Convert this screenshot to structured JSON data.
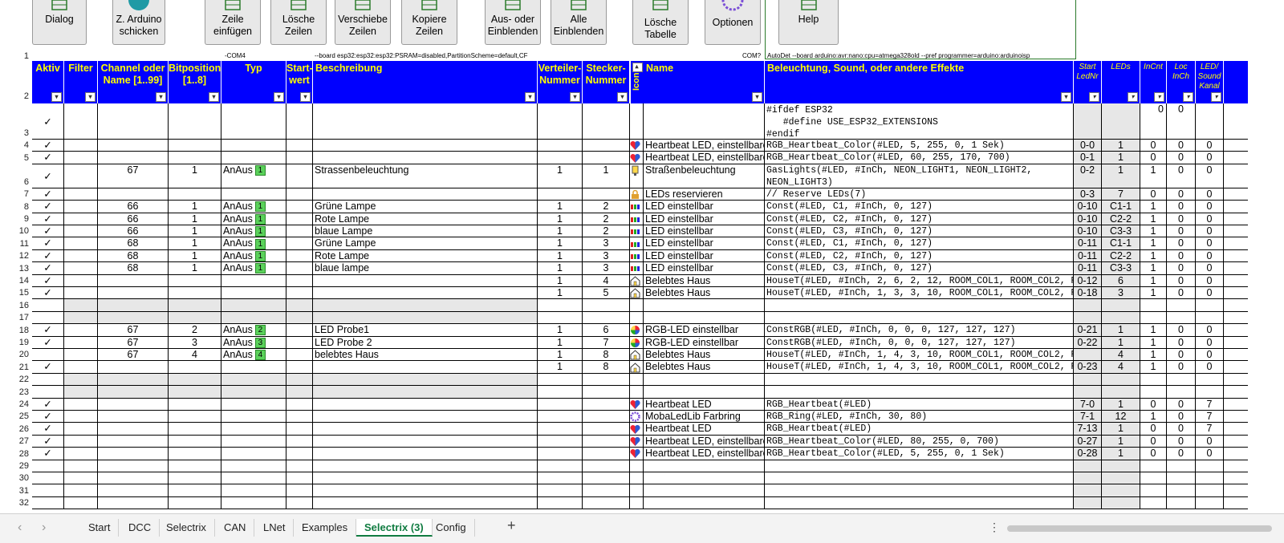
{
  "ribbon": {
    "buttons": [
      {
        "label": "Dialog"
      },
      {
        "label": "Z. Arduino\nschicken"
      },
      {
        "label": "Zeile\neinfügen"
      },
      {
        "label": "Lösche\nZeilen"
      },
      {
        "label": "Verschiebe\nZeilen"
      },
      {
        "label": "Kopiere\nZeilen"
      },
      {
        "label": "Aus- oder\nEinblenden"
      },
      {
        "label": "Alle\nEinblenden"
      },
      {
        "label": "Lösche\nTabelle"
      },
      {
        "label": "Optionen"
      },
      {
        "label": "Help"
      }
    ]
  },
  "row1": {
    "num": "1",
    "com4": "-COM4",
    "board": "--board esp32:esp32:esp32:PSRAM=disabled,PartitionScheme=default,CF",
    "com": "COM?",
    "autodet": "AutoDet --board arduino:avr:nano:cpu=atmega328old --pref programmer=arduino:arduinoisp"
  },
  "header": {
    "num": "2",
    "cols": [
      "Aktiv",
      "Filter",
      "Channel oder Name [1..99]",
      "Bitposition [1..8]",
      "Typ",
      "Start-wert",
      "Beschreibung",
      "Verteiler-Nummer",
      "Stecker-Nummer",
      "Icon",
      "Name",
      "Beleuchtung, Sound, oder andere Effekte",
      "Start LedNr",
      "LEDs",
      "InCnt",
      "Loc InCh",
      "LED/ Sound Kanal"
    ]
  },
  "rows": [
    {
      "n": "3",
      "a": "✓",
      "ch": "",
      "bp": "",
      "typ": "",
      "tb": "",
      "desc": "",
      "v": "",
      "s": "",
      "icon": "",
      "name": "",
      "eff": "#ifdef ESP32\n   #define USE_ESP32_EXTENSIONS\n#endif",
      "st": "",
      "leds": "",
      "inc": "0",
      "loc": "0",
      "kan": ""
    },
    {
      "n": "4",
      "a": "✓",
      "ch": "",
      "bp": "",
      "typ": "",
      "tb": "",
      "desc": "",
      "v": "",
      "s": "",
      "icon": "heart",
      "name": "Heartbeat LED, einstellbare",
      "eff": "RGB_Heartbeat_Color(#LED, 5, 255, 0, 1 Sek)",
      "st": "0-0",
      "leds": "1",
      "inc": "0",
      "loc": "0",
      "kan": "0"
    },
    {
      "n": "5",
      "a": "✓",
      "ch": "",
      "bp": "",
      "typ": "",
      "tb": "",
      "desc": "",
      "v": "",
      "s": "",
      "icon": "heart",
      "name": "Heartbeat LED, einstellbare",
      "eff": "RGB_Heartbeat_Color(#LED, 60, 255, 170, 700)",
      "st": "0-1",
      "leds": "1",
      "inc": "0",
      "loc": "0",
      "kan": "0"
    },
    {
      "n": "6",
      "a": "✓",
      "ch": "67",
      "bp": "1",
      "typ": "AnAus",
      "tb": "1",
      "desc": "Strassenbeleuchtung",
      "v": "1",
      "s": "1",
      "icon": "lamp",
      "name": "Straßenbeleuchtung",
      "eff": "GasLights(#LED, #InCh, NEON_LIGHT1, NEON_LIGHT2,\nNEON_LIGHT3)",
      "st": "0-2",
      "leds": "1",
      "inc": "1",
      "loc": "0",
      "kan": "0"
    },
    {
      "n": "7",
      "a": "✓",
      "ch": "",
      "bp": "",
      "typ": "",
      "tb": "",
      "desc": "",
      "v": "",
      "s": "",
      "icon": "lock",
      "name": "LEDs reservieren",
      "eff": "// Reserve LEDs(7)",
      "st": "0-3",
      "leds": "7",
      "inc": "0",
      "loc": "0",
      "kan": "0"
    },
    {
      "n": "8",
      "a": "✓",
      "ch": "66",
      "bp": "1",
      "typ": "AnAus",
      "tb": "1",
      "desc": "Grüne Lampe",
      "v": "1",
      "s": "2",
      "icon": "bars",
      "name": "LED einstellbar",
      "eff": "Const(#LED, C1, #InCh, 0, 127)",
      "st": "0-10",
      "leds": "C1-1",
      "inc": "1",
      "loc": "0",
      "kan": "0"
    },
    {
      "n": "9",
      "a": "✓",
      "ch": "66",
      "bp": "1",
      "typ": "AnAus",
      "tb": "1",
      "desc": "Rote Lampe",
      "v": "1",
      "s": "2",
      "icon": "bars",
      "name": "LED einstellbar",
      "eff": "Const(#LED, C2, #InCh, 0, 127)",
      "st": "0-10",
      "leds": "C2-2",
      "inc": "1",
      "loc": "0",
      "kan": "0"
    },
    {
      "n": "10",
      "a": "✓",
      "ch": "66",
      "bp": "1",
      "typ": "AnAus",
      "tb": "1",
      "desc": "blaue Lampe",
      "v": "1",
      "s": "2",
      "icon": "bars",
      "name": "LED einstellbar",
      "eff": "Const(#LED, C3, #InCh, 0, 127)",
      "st": "0-10",
      "leds": "C3-3",
      "inc": "1",
      "loc": "0",
      "kan": "0"
    },
    {
      "n": "11",
      "a": "✓",
      "ch": "68",
      "bp": "1",
      "typ": "AnAus",
      "tb": "1",
      "desc": "Grüne Lampe",
      "v": "1",
      "s": "3",
      "icon": "bars",
      "name": "LED einstellbar",
      "eff": "Const(#LED, C1, #InCh, 0, 127)",
      "st": "0-11",
      "leds": "C1-1",
      "inc": "1",
      "loc": "0",
      "kan": "0"
    },
    {
      "n": "12",
      "a": "✓",
      "ch": "68",
      "bp": "1",
      "typ": "AnAus",
      "tb": "1",
      "desc": "Rote Lampe",
      "v": "1",
      "s": "3",
      "icon": "bars",
      "name": "LED einstellbar",
      "eff": "Const(#LED, C2, #InCh, 0, 127)",
      "st": "0-11",
      "leds": "C2-2",
      "inc": "1",
      "loc": "0",
      "kan": "0"
    },
    {
      "n": "13",
      "a": "✓",
      "ch": "68",
      "bp": "1",
      "typ": "AnAus",
      "tb": "1",
      "desc": "blaue lampe",
      "v": "1",
      "s": "3",
      "icon": "bars",
      "name": "LED einstellbar",
      "eff": "Const(#LED, C3, #InCh, 0, 127)",
      "st": "0-11",
      "leds": "C3-3",
      "inc": "1",
      "loc": "0",
      "kan": "0"
    },
    {
      "n": "14",
      "a": "✓",
      "ch": "",
      "bp": "",
      "typ": "",
      "tb": "",
      "desc": "",
      "v": "1",
      "s": "4",
      "icon": "house",
      "name": "Belebtes Haus",
      "eff": "HouseT(#LED, #InCh, 2, 6, 2, 12, ROOM_COL1, ROOM_COL2, ROOM_C",
      "st": "0-12",
      "leds": "6",
      "inc": "1",
      "loc": "0",
      "kan": "0"
    },
    {
      "n": "15",
      "a": "✓",
      "ch": "",
      "bp": "",
      "typ": "",
      "tb": "",
      "desc": "",
      "v": "1",
      "s": "5",
      "icon": "house",
      "name": "Belebtes Haus",
      "eff": "HouseT(#LED, #InCh, 1, 3, 3, 10, ROOM_COL1, ROOM_COL2, ROOM_C",
      "st": "0-18",
      "leds": "3",
      "inc": "1",
      "loc": "0",
      "kan": "0"
    },
    {
      "n": "16",
      "a": "",
      "ch": "",
      "bp": "",
      "typ": "",
      "tb": "",
      "desc": "",
      "v": "",
      "s": "",
      "icon": "",
      "name": "",
      "eff": "",
      "st": "",
      "leds": "",
      "inc": "",
      "loc": "",
      "kan": ""
    },
    {
      "n": "17",
      "a": "",
      "ch": "",
      "bp": "",
      "typ": "",
      "tb": "",
      "desc": "",
      "v": "",
      "s": "",
      "icon": "",
      "name": "",
      "eff": "",
      "st": "",
      "leds": "",
      "inc": "",
      "loc": "",
      "kan": ""
    },
    {
      "n": "18",
      "a": "✓",
      "ch": "67",
      "bp": "2",
      "typ": "AnAus",
      "tb": "2",
      "desc": "LED Probe1",
      "v": "1",
      "s": "6",
      "icon": "rgb",
      "name": "RGB-LED einstellbar",
      "eff": "ConstRGB(#LED, #InCh, 0, 0, 0, 127, 127, 127)",
      "st": "0-21",
      "leds": "1",
      "inc": "1",
      "loc": "0",
      "kan": "0"
    },
    {
      "n": "19",
      "a": "✓",
      "ch": "67",
      "bp": "3",
      "typ": "AnAus",
      "tb": "3",
      "desc": "LED Probe 2",
      "v": "1",
      "s": "7",
      "icon": "rgb",
      "name": "RGB-LED einstellbar",
      "eff": "ConstRGB(#LED, #InCh, 0, 0, 0, 127, 127, 127)",
      "st": "0-22",
      "leds": "1",
      "inc": "1",
      "loc": "0",
      "kan": "0"
    },
    {
      "n": "20",
      "a": "",
      "ch": "67",
      "bp": "4",
      "typ": "AnAus",
      "tb": "4",
      "desc": "belebtes Haus",
      "v": "1",
      "s": "8",
      "icon": "house",
      "name": "Belebtes Haus",
      "eff": "HouseT(#LED, #InCh, 1, 4, 3, 10, ROOM_COL1, ROOM_COL2, ROOM_C",
      "st": "",
      "leds": "4",
      "inc": "1",
      "loc": "0",
      "kan": "0"
    },
    {
      "n": "21",
      "a": "✓",
      "ch": "",
      "bp": "",
      "typ": "",
      "tb": "",
      "desc": "",
      "v": "1",
      "s": "8",
      "icon": "house",
      "name": "Belebtes Haus",
      "eff": "HouseT(#LED, #InCh, 1, 4, 3, 10, ROOM_COL1, ROOM_COL2, ROOM_C",
      "st": "0-23",
      "leds": "4",
      "inc": "1",
      "loc": "0",
      "kan": "0"
    },
    {
      "n": "22",
      "a": "",
      "ch": "",
      "bp": "",
      "typ": "",
      "tb": "",
      "desc": "",
      "v": "",
      "s": "",
      "icon": "",
      "name": "",
      "eff": "",
      "st": "",
      "leds": "",
      "inc": "",
      "loc": "",
      "kan": ""
    },
    {
      "n": "23",
      "a": "",
      "ch": "",
      "bp": "",
      "typ": "",
      "tb": "",
      "desc": "",
      "v": "",
      "s": "",
      "icon": "",
      "name": "",
      "eff": "",
      "st": "",
      "leds": "",
      "inc": "",
      "loc": "",
      "kan": ""
    },
    {
      "n": "24",
      "a": "✓",
      "ch": "",
      "bp": "",
      "typ": "",
      "tb": "",
      "desc": "",
      "v": "",
      "s": "",
      "icon": "heart",
      "name": "Heartbeat LED",
      "eff": "RGB_Heartbeat(#LED)",
      "st": "7-0",
      "leds": "1",
      "inc": "0",
      "loc": "0",
      "kan": "7"
    },
    {
      "n": "25",
      "a": "✓",
      "ch": "",
      "bp": "",
      "typ": "",
      "tb": "",
      "desc": "",
      "v": "",
      "s": "",
      "icon": "ring",
      "name": "MobaLedLib Farbring",
      "eff": "RGB_Ring(#LED, #InCh, 30, 80)",
      "st": "7-1",
      "leds": "12",
      "inc": "1",
      "loc": "0",
      "kan": "7"
    },
    {
      "n": "26",
      "a": "✓",
      "ch": "",
      "bp": "",
      "typ": "",
      "tb": "",
      "desc": "",
      "v": "",
      "s": "",
      "icon": "heart",
      "name": "Heartbeat LED",
      "eff": "RGB_Heartbeat(#LED)",
      "st": "7-13",
      "leds": "1",
      "inc": "0",
      "loc": "0",
      "kan": "7"
    },
    {
      "n": "27",
      "a": "✓",
      "ch": "",
      "bp": "",
      "typ": "",
      "tb": "",
      "desc": "",
      "v": "",
      "s": "",
      "icon": "heart",
      "name": "Heartbeat LED, einstellbare",
      "eff": "RGB_Heartbeat_Color(#LED, 80, 255, 0, 700)",
      "st": "0-27",
      "leds": "1",
      "inc": "0",
      "loc": "0",
      "kan": "0"
    },
    {
      "n": "28",
      "a": "✓",
      "ch": "",
      "bp": "",
      "typ": "",
      "tb": "",
      "desc": "",
      "v": "",
      "s": "",
      "icon": "heart",
      "name": "Heartbeat LED, einstellbare",
      "eff": "RGB_Heartbeat_Color(#LED, 5, 255, 0, 1 Sek)",
      "st": "0-28",
      "leds": "1",
      "inc": "0",
      "loc": "0",
      "kan": "0"
    },
    {
      "n": "29",
      "a": "",
      "ch": "",
      "bp": "",
      "typ": "",
      "tb": "",
      "desc": "",
      "v": "",
      "s": "",
      "icon": "",
      "name": "",
      "eff": "",
      "st": "",
      "leds": "",
      "inc": "",
      "loc": "",
      "kan": ""
    },
    {
      "n": "30",
      "a": "",
      "ch": "",
      "bp": "",
      "typ": "",
      "tb": "",
      "desc": "",
      "v": "",
      "s": "",
      "icon": "",
      "name": "",
      "eff": "",
      "st": "",
      "leds": "",
      "inc": "",
      "loc": "",
      "kan": ""
    },
    {
      "n": "31",
      "a": "",
      "ch": "",
      "bp": "",
      "typ": "",
      "tb": "",
      "desc": "",
      "v": "",
      "s": "",
      "icon": "",
      "name": "",
      "eff": "",
      "st": "",
      "leds": "",
      "inc": "",
      "loc": "",
      "kan": ""
    },
    {
      "n": "32",
      "a": "",
      "ch": "",
      "bp": "",
      "typ": "",
      "tb": "",
      "desc": "",
      "v": "",
      "s": "",
      "icon": "",
      "name": "",
      "eff": "",
      "st": "",
      "leds": "",
      "inc": "",
      "loc": "",
      "kan": ""
    }
  ],
  "tabs": {
    "nav_prev": "‹",
    "nav_next": "›",
    "items": [
      "Start",
      "DCC",
      "Selectrix",
      "CAN",
      "LNet",
      "Examples",
      "Selectrix (3)",
      "Config"
    ],
    "active": "Selectrix (3)",
    "add": "+",
    "more": "⋮"
  },
  "colors": {
    "header_bg": "#0000ff",
    "header_text": "#ffff00",
    "typ_box": "#5bd25b",
    "active_tab": "#107c41"
  }
}
